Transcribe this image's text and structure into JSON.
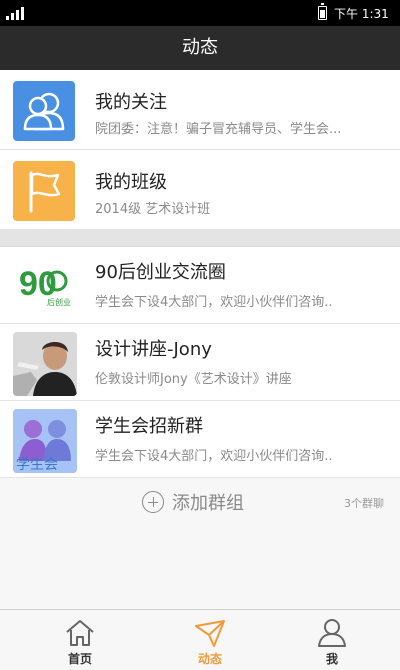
{
  "status_bar": {
    "time": "下午 1:31"
  },
  "title": "动态",
  "items": [
    {
      "name": "我的关注",
      "desc": "院团委：注意！骗子冒充辅导员、学生会..."
    },
    {
      "name": "我的班级",
      "desc": "2014级 艺术设计班"
    }
  ],
  "groups": [
    {
      "name": "90后创业交流圈",
      "desc": "学生会下设4大部门，欢迎小伙伴们咨询..",
      "icon_text": "90",
      "icon_sub": "后创业"
    },
    {
      "name": "设计讲座-Jony",
      "desc": "伦敦设计师Jony《艺术设计》讲座"
    },
    {
      "name": "学生会招新群",
      "desc": "学生会下设4大部门，欢迎小伙伴们咨询..",
      "icon_text": "学生会"
    }
  ],
  "add_group": {
    "label": "添加群组",
    "count": "3个群聊"
  },
  "tabs": [
    {
      "label": "首页"
    },
    {
      "label": "动态"
    },
    {
      "label": "我"
    }
  ],
  "colors": {
    "accent": "#f29a38",
    "blue": "#4a90e2",
    "orange": "#f7b24a",
    "titlebar": "#2b2b2b"
  }
}
